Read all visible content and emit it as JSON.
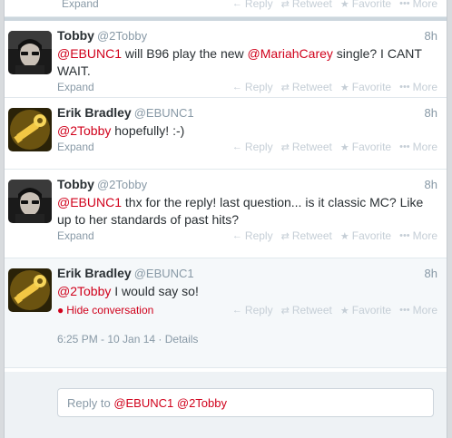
{
  "top": {
    "expand_label": "Expand",
    "reply": "Reply",
    "retweet": "Retweet",
    "favorite": "Favorite",
    "more": "More"
  },
  "tweets": [
    {
      "name": "Tobby",
      "handle": "@2Tobby",
      "time": "8h",
      "mention": "@EBUNC1",
      "text_a": " will B96 play the new ",
      "mention2": "@MariahCarey",
      "text_b": " single? I CANT WAIT.",
      "expand": "Expand"
    },
    {
      "name": "Erik Bradley",
      "handle": "@EBUNC1",
      "time": "8h",
      "mention": "@2Tobby",
      "text": " hopefully!  :-)",
      "expand": "Expand"
    },
    {
      "name": "Tobby",
      "handle": "@2Tobby",
      "time": "8h",
      "mention": "@EBUNC1",
      "text": " thx for the reply! last question... is it classic MC? Like up to her standards of past hits?",
      "expand": "Expand"
    },
    {
      "name": "Erik Bradley",
      "handle": "@EBUNC1",
      "time": "8h",
      "mention": "@2Tobby",
      "text": " I would say so!",
      "hide": "Hide conversation",
      "details": "6:25 PM - 10 Jan 14 · Details"
    }
  ],
  "actions": {
    "reply": "Reply",
    "retweet": "Retweet",
    "favorite": "Favorite",
    "more": "More"
  },
  "reply_box": {
    "prefix": "Reply to ",
    "mention1": "@EBUNC1",
    "mention2": "@2Tobby"
  },
  "colors": {
    "accent": "#d0011b",
    "muted": "#8899a6"
  },
  "icons": [
    "reply-icon",
    "retweet-icon",
    "star-icon",
    "more-dots-icon",
    "speech-bubble-icon"
  ]
}
